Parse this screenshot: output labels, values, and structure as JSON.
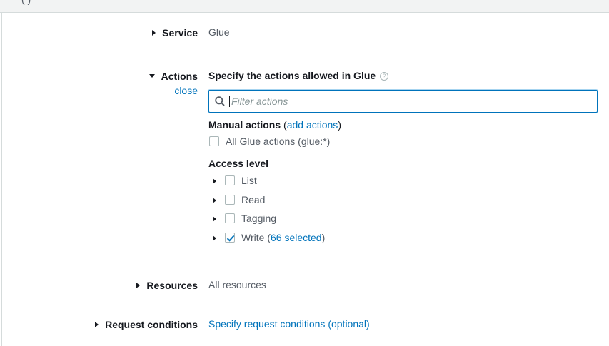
{
  "top_bar": {
    "partial_text": "( )"
  },
  "service": {
    "label": "Service",
    "value": "Glue"
  },
  "actions": {
    "label": "Actions",
    "close_label": "close",
    "heading": "Specify the actions allowed in Glue",
    "help_glyph": "?",
    "filter": {
      "placeholder": "Filter actions",
      "value": ""
    },
    "manual": {
      "heading": "Manual actions",
      "add_open": "(",
      "add_link": "add actions",
      "add_close": ")",
      "all_label": "All Glue actions (glue:*)",
      "all_checked": false
    },
    "access_level": {
      "heading": "Access level",
      "items": [
        {
          "label": "List",
          "checked": false
        },
        {
          "label": "Read",
          "checked": false
        },
        {
          "label": "Tagging",
          "checked": false
        },
        {
          "label": "Write",
          "checked": true,
          "suffix_open": "(",
          "selected_link": "66 selected",
          "suffix_close": ")"
        }
      ]
    }
  },
  "resources": {
    "label": "Resources",
    "value": "All resources"
  },
  "request_conditions": {
    "label": "Request conditions",
    "link": "Specify request conditions (optional)"
  },
  "colors": {
    "link": "#0073bb",
    "focus_border": "#0073bb",
    "divider": "#d5dbdb"
  }
}
